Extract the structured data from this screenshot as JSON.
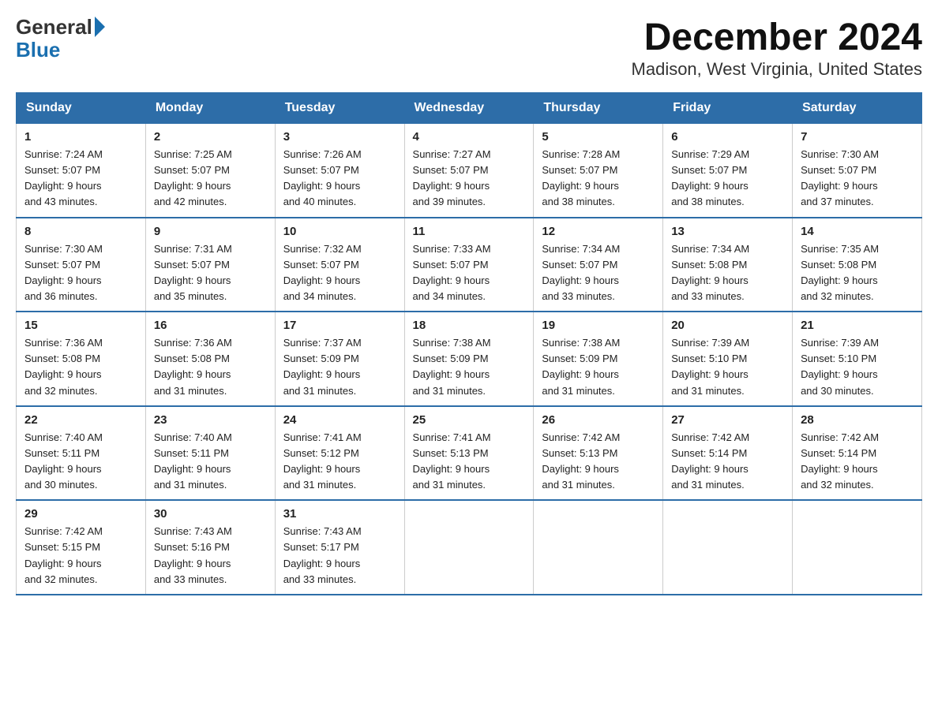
{
  "logo": {
    "line1": "General",
    "line2": "Blue"
  },
  "title": "December 2024",
  "subtitle": "Madison, West Virginia, United States",
  "days_of_week": [
    "Sunday",
    "Monday",
    "Tuesday",
    "Wednesday",
    "Thursday",
    "Friday",
    "Saturday"
  ],
  "weeks": [
    [
      {
        "day": "1",
        "sunrise": "7:24 AM",
        "sunset": "5:07 PM",
        "daylight": "9 hours and 43 minutes."
      },
      {
        "day": "2",
        "sunrise": "7:25 AM",
        "sunset": "5:07 PM",
        "daylight": "9 hours and 42 minutes."
      },
      {
        "day": "3",
        "sunrise": "7:26 AM",
        "sunset": "5:07 PM",
        "daylight": "9 hours and 40 minutes."
      },
      {
        "day": "4",
        "sunrise": "7:27 AM",
        "sunset": "5:07 PM",
        "daylight": "9 hours and 39 minutes."
      },
      {
        "day": "5",
        "sunrise": "7:28 AM",
        "sunset": "5:07 PM",
        "daylight": "9 hours and 38 minutes."
      },
      {
        "day": "6",
        "sunrise": "7:29 AM",
        "sunset": "5:07 PM",
        "daylight": "9 hours and 38 minutes."
      },
      {
        "day": "7",
        "sunrise": "7:30 AM",
        "sunset": "5:07 PM",
        "daylight": "9 hours and 37 minutes."
      }
    ],
    [
      {
        "day": "8",
        "sunrise": "7:30 AM",
        "sunset": "5:07 PM",
        "daylight": "9 hours and 36 minutes."
      },
      {
        "day": "9",
        "sunrise": "7:31 AM",
        "sunset": "5:07 PM",
        "daylight": "9 hours and 35 minutes."
      },
      {
        "day": "10",
        "sunrise": "7:32 AM",
        "sunset": "5:07 PM",
        "daylight": "9 hours and 34 minutes."
      },
      {
        "day": "11",
        "sunrise": "7:33 AM",
        "sunset": "5:07 PM",
        "daylight": "9 hours and 34 minutes."
      },
      {
        "day": "12",
        "sunrise": "7:34 AM",
        "sunset": "5:07 PM",
        "daylight": "9 hours and 33 minutes."
      },
      {
        "day": "13",
        "sunrise": "7:34 AM",
        "sunset": "5:08 PM",
        "daylight": "9 hours and 33 minutes."
      },
      {
        "day": "14",
        "sunrise": "7:35 AM",
        "sunset": "5:08 PM",
        "daylight": "9 hours and 32 minutes."
      }
    ],
    [
      {
        "day": "15",
        "sunrise": "7:36 AM",
        "sunset": "5:08 PM",
        "daylight": "9 hours and 32 minutes."
      },
      {
        "day": "16",
        "sunrise": "7:36 AM",
        "sunset": "5:08 PM",
        "daylight": "9 hours and 31 minutes."
      },
      {
        "day": "17",
        "sunrise": "7:37 AM",
        "sunset": "5:09 PM",
        "daylight": "9 hours and 31 minutes."
      },
      {
        "day": "18",
        "sunrise": "7:38 AM",
        "sunset": "5:09 PM",
        "daylight": "9 hours and 31 minutes."
      },
      {
        "day": "19",
        "sunrise": "7:38 AM",
        "sunset": "5:09 PM",
        "daylight": "9 hours and 31 minutes."
      },
      {
        "day": "20",
        "sunrise": "7:39 AM",
        "sunset": "5:10 PM",
        "daylight": "9 hours and 31 minutes."
      },
      {
        "day": "21",
        "sunrise": "7:39 AM",
        "sunset": "5:10 PM",
        "daylight": "9 hours and 30 minutes."
      }
    ],
    [
      {
        "day": "22",
        "sunrise": "7:40 AM",
        "sunset": "5:11 PM",
        "daylight": "9 hours and 30 minutes."
      },
      {
        "day": "23",
        "sunrise": "7:40 AM",
        "sunset": "5:11 PM",
        "daylight": "9 hours and 31 minutes."
      },
      {
        "day": "24",
        "sunrise": "7:41 AM",
        "sunset": "5:12 PM",
        "daylight": "9 hours and 31 minutes."
      },
      {
        "day": "25",
        "sunrise": "7:41 AM",
        "sunset": "5:13 PM",
        "daylight": "9 hours and 31 minutes."
      },
      {
        "day": "26",
        "sunrise": "7:42 AM",
        "sunset": "5:13 PM",
        "daylight": "9 hours and 31 minutes."
      },
      {
        "day": "27",
        "sunrise": "7:42 AM",
        "sunset": "5:14 PM",
        "daylight": "9 hours and 31 minutes."
      },
      {
        "day": "28",
        "sunrise": "7:42 AM",
        "sunset": "5:14 PM",
        "daylight": "9 hours and 32 minutes."
      }
    ],
    [
      {
        "day": "29",
        "sunrise": "7:42 AM",
        "sunset": "5:15 PM",
        "daylight": "9 hours and 32 minutes."
      },
      {
        "day": "30",
        "sunrise": "7:43 AM",
        "sunset": "5:16 PM",
        "daylight": "9 hours and 33 minutes."
      },
      {
        "day": "31",
        "sunrise": "7:43 AM",
        "sunset": "5:17 PM",
        "daylight": "9 hours and 33 minutes."
      },
      null,
      null,
      null,
      null
    ]
  ],
  "labels": {
    "sunrise": "Sunrise:",
    "sunset": "Sunset:",
    "daylight": "Daylight:"
  }
}
